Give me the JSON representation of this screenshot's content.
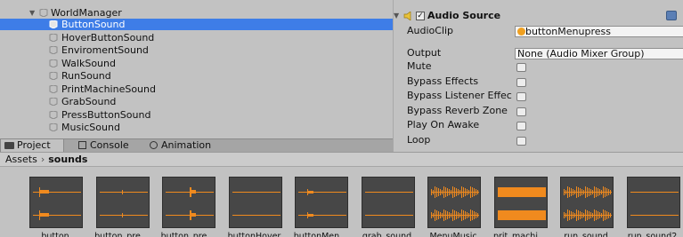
{
  "hierarchy": {
    "parent": "WorldManager",
    "children": [
      {
        "name": "ButtonSound",
        "selected": true
      },
      {
        "name": "HoverButtonSound"
      },
      {
        "name": "EnviromentSound"
      },
      {
        "name": "WalkSound"
      },
      {
        "name": "RunSound"
      },
      {
        "name": "PrintMachineSound"
      },
      {
        "name": "GrabSound"
      },
      {
        "name": "PressButtonSound"
      },
      {
        "name": "MusicSound"
      }
    ]
  },
  "inspector": {
    "component": "Audio Source",
    "audio_clip_label": "AudioClip",
    "audio_clip_value": "buttonMenupress",
    "output_label": "Output",
    "output_value": "None (Audio Mixer Group)",
    "props": [
      "Mute",
      "Bypass Effects",
      "Bypass Listener Effec",
      "Bypass Reverb Zone",
      "Play On Awake",
      "Loop"
    ]
  },
  "tabs": [
    "Project",
    "Console",
    "Animation"
  ],
  "breadcrumb": {
    "root": "Assets",
    "current": "sounds"
  },
  "assets": [
    {
      "label": "button",
      "wave": "spike"
    },
    {
      "label": "button_pre...",
      "wave": "small"
    },
    {
      "label": "button_pre...",
      "wave": "mid"
    },
    {
      "label": "buttonHover",
      "wave": "flat"
    },
    {
      "label": "buttonMen...",
      "wave": "spike2"
    },
    {
      "label": "grab_sound",
      "wave": "flat"
    },
    {
      "label": "MenuMusic",
      "wave": "music"
    },
    {
      "label": "prit_machi...",
      "wave": "dense"
    },
    {
      "label": "run_sound",
      "wave": "music"
    },
    {
      "label": "run_sound2",
      "wave": "flat"
    }
  ],
  "colors": {
    "selection": "#3e7de7",
    "waveform": "#f08a1e",
    "thumb_bg": "#474747"
  }
}
